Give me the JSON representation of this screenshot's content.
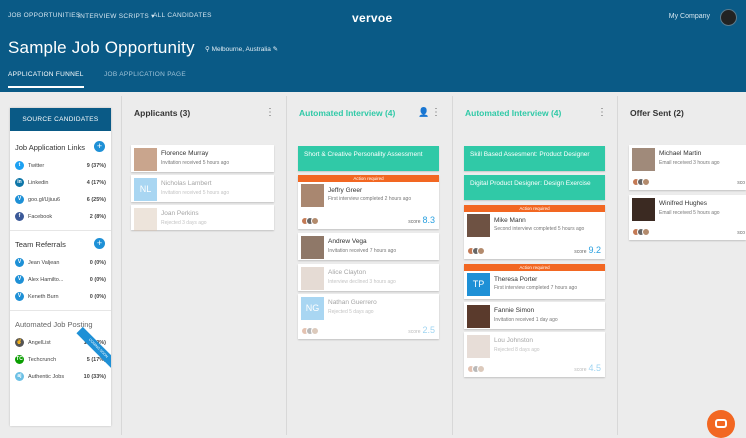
{
  "topnav": {
    "job_opportunities": "JOB OPPORTUNITIES",
    "interview_scripts": "INTERVIEW SCRIPTS ▾",
    "all_candidates": "ALL CANDIDATES",
    "brand": "vervoe",
    "company": "My Company"
  },
  "header": {
    "title": "Sample Job Opportunity",
    "location": "Melbourne, Australia"
  },
  "tabs": {
    "funnel": "APPLICATION FUNNEL",
    "page": "JOB APPLICATION PAGE"
  },
  "sidebar": {
    "source_button": "SOURCE CANDIDATES",
    "links_title": "Job Application Links",
    "links": [
      {
        "label": "Twitter",
        "value": "9 (37%)",
        "color": "#1da1f2",
        "icon": "twitter-icon",
        "glyph": "t"
      },
      {
        "label": "Linkedin",
        "value": "4 (17%)",
        "color": "#0e76a8",
        "icon": "linkedin-icon",
        "glyph": "in"
      },
      {
        "label": "goo.gl/Ujiuu6",
        "value": "6 (25%)",
        "color": "#1e90d6",
        "icon": "link-icon",
        "glyph": "V"
      },
      {
        "label": "Facebook",
        "value": "2 (8%)",
        "color": "#3b5998",
        "icon": "facebook-icon",
        "glyph": "f"
      }
    ],
    "referrals_title": "Team Referrals",
    "referrals": [
      {
        "label": "Jean Valjean",
        "value": "0 (0%)"
      },
      {
        "label": "Alex Hamilto...",
        "value": "0 (0%)"
      },
      {
        "label": "Keneth Burn",
        "value": "0 (0%)"
      }
    ],
    "posting_title": "Automated Job Posting",
    "ribbon": "COMING SOON",
    "postings": [
      {
        "label": "AngelList",
        "value": "15 (50%)",
        "color": "#555",
        "icon": "angellist-icon",
        "glyph": "✌"
      },
      {
        "label": "Techcrunch",
        "value": "5 (17%)",
        "color": "#0a9e01",
        "icon": "techcrunch-icon",
        "glyph": "TC"
      },
      {
        "label": "Authentic Jobs",
        "value": "10 (33%)",
        "color": "#6cc0e5",
        "icon": "authentic-jobs-icon",
        "glyph": "aj"
      }
    ]
  },
  "columns": {
    "applicants": {
      "title": "Applicants (3)"
    },
    "auto1": {
      "title": "Automated Interview (4)"
    },
    "auto2": {
      "title": "Automated Interview (4)"
    },
    "offer": {
      "title": "Offer Sent (2)"
    }
  },
  "cards": {
    "florence": {
      "name": "Florence Murray",
      "sub": "Invitation received 5 hours ago"
    },
    "nicholas": {
      "name": "Nicholas Lambert",
      "sub": "Invitation received 5 hours ago",
      "initials": "NL"
    },
    "joan": {
      "name": "Joan Perkins",
      "sub": "Rejected 3 days ago"
    },
    "stage_short": "Short & Creative Personality Assessment",
    "action": "Action required",
    "jeffry": {
      "name": "Jeffry Greer",
      "sub": "First interview completed 2 hours ago",
      "score": "8.3"
    },
    "andrew": {
      "name": "Andrew Vega",
      "sub": "Invitation received 7 hours ago"
    },
    "alice": {
      "name": "Alice Clayton",
      "sub": "Interview declined 3 hours ago"
    },
    "nathan": {
      "name": "Nathan Guerrero",
      "sub": "Rejected 5 days ago",
      "initials": "NG",
      "score": "2.5"
    },
    "stage_skill": "Skill Based Assesment: Product Designer",
    "stage_digital": "Digital Product Designer: Design Exercise",
    "mike": {
      "name": "Mike Mann",
      "sub": "Second interview completed 5 hours ago",
      "score": "9.2"
    },
    "theresa": {
      "name": "Theresa Porter",
      "sub": "First interview completed 7 hours ago",
      "initials": "TP"
    },
    "fannie": {
      "name": "Fannie Simon",
      "sub": "Invitation received 1 day ago"
    },
    "lou": {
      "name": "Lou Johnston",
      "sub": "Rejected 8 days ago",
      "score": "4.5"
    },
    "michael": {
      "name": "Michael Martin",
      "sub": "Email received 3 hours ago",
      "score_label": "sco"
    },
    "winifred": {
      "name": "Winifred Hughes",
      "sub": "Email received 5 hours ago",
      "score_label": "sco"
    },
    "score_label": "score"
  }
}
